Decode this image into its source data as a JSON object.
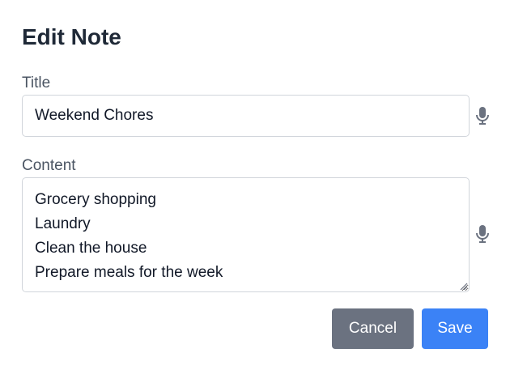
{
  "dialog": {
    "heading": "Edit Note",
    "title_label": "Title",
    "title_value": "Weekend Chores",
    "content_label": "Content",
    "content_value": "Grocery shopping\nLaundry\nClean the house\nPrepare meals for the week",
    "cancel_label": "Cancel",
    "save_label": "Save"
  },
  "icons": {
    "title_voice": "microphone-icon",
    "content_voice": "microphone-icon",
    "resize": "resize-grip-icon"
  },
  "colors": {
    "heading": "#1f2937",
    "label": "#4b5563",
    "border": "#d1d5db",
    "cancel_bg": "#6b7280",
    "save_bg": "#3b82f6",
    "icon": "#6b7280"
  }
}
